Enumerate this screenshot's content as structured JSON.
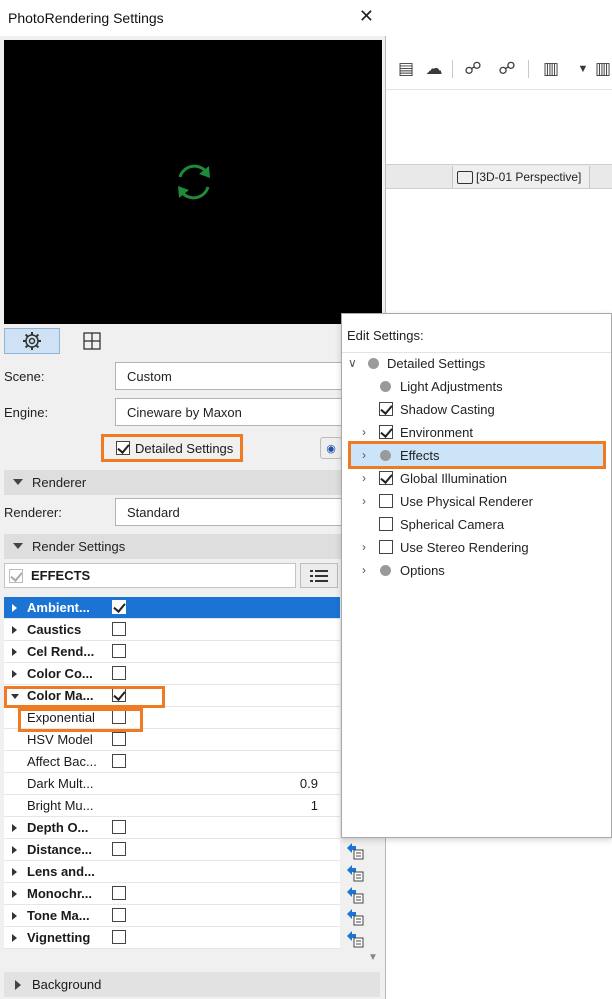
{
  "dialog": {
    "title": "PhotoRendering Settings",
    "close_icon": "close-icon",
    "scene_label": "Scene:",
    "scene_value": "Custom",
    "engine_label": "Engine:",
    "engine_value": "Cineware by Maxon",
    "detailed_settings_label": "Detailed Settings",
    "renderer_section": "Renderer",
    "renderer_label": "Renderer:",
    "renderer_value": "Standard",
    "render_settings_section": "Render Settings",
    "effects_header": "EFFECTS",
    "background_section": "Background"
  },
  "tree": {
    "rows": [
      {
        "label": "Ambient...",
        "checked": true
      },
      {
        "label": "Caustics",
        "checked": false
      },
      {
        "label": "Cel Rend...",
        "checked": false
      },
      {
        "label": "Color Co...",
        "checked": false
      },
      {
        "label": "Color Ma...",
        "checked": true
      },
      {
        "label": "Exponential",
        "checked": false
      },
      {
        "label": "HSV Model",
        "checked": false
      },
      {
        "label": "Affect Bac...",
        "checked": false
      },
      {
        "label": "Dark Mult...",
        "value": "0.9"
      },
      {
        "label": "Bright Mu...",
        "value": "1"
      },
      {
        "label": "Depth O...",
        "checked": false
      },
      {
        "label": "Distance...",
        "checked": false
      },
      {
        "label": "Lens and..."
      },
      {
        "label": "Monochr...",
        "checked": false
      },
      {
        "label": "Tone Ma...",
        "checked": false
      },
      {
        "label": "Vignetting",
        "checked": false
      }
    ]
  },
  "popup": {
    "title": "Edit Settings:",
    "items": [
      {
        "label": "Detailed Settings"
      },
      {
        "label": "Light Adjustments"
      },
      {
        "label": "Shadow Casting",
        "checked": true
      },
      {
        "label": "Environment",
        "checked": true
      },
      {
        "label": "Effects"
      },
      {
        "label": "Global Illumination",
        "checked": true
      },
      {
        "label": "Use Physical Renderer",
        "checked": false
      },
      {
        "label": "Spherical Camera",
        "checked": false
      },
      {
        "label": "Use Stereo Rendering",
        "checked": false
      },
      {
        "label": "Options"
      }
    ]
  },
  "background_app": {
    "view_tab": "[3D-01 Perspective]"
  },
  "colors": {
    "highlight_orange": "#f07a24",
    "selected_blue": "#1b74d4",
    "spinner_green": "#1f8a3a"
  }
}
